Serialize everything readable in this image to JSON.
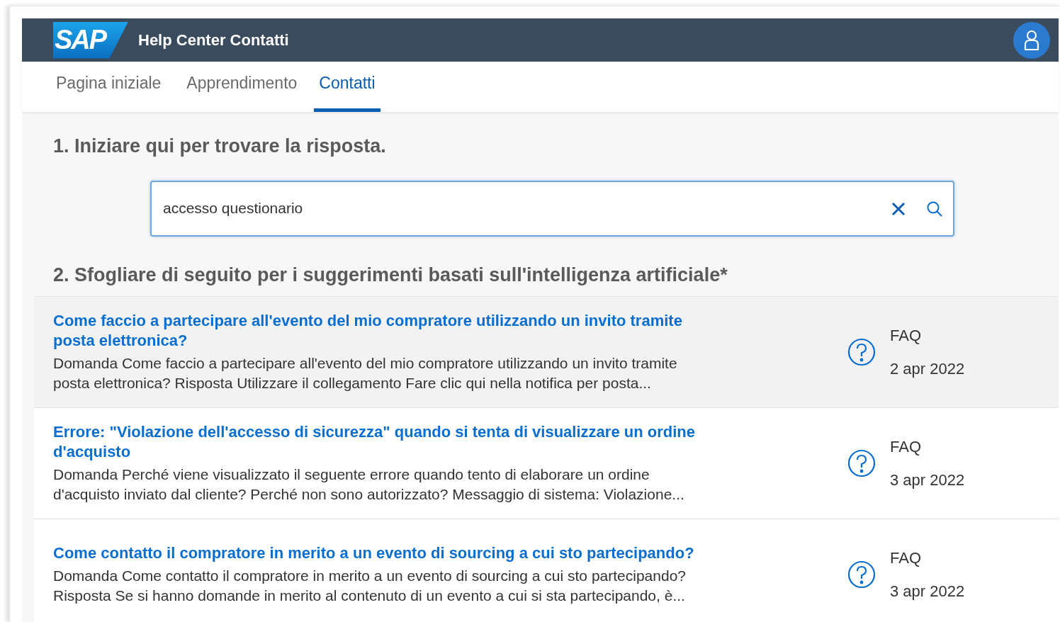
{
  "header": {
    "logo": "SAP",
    "title": "Help Center Contatti"
  },
  "tabs": [
    {
      "label": "Pagina iniziale",
      "selected": false
    },
    {
      "label": "Apprendimento",
      "selected": false
    },
    {
      "label": "Contatti",
      "selected": true
    }
  ],
  "step1": {
    "heading": "1. Iniziare qui per trovare la risposta.",
    "search": {
      "value": "accesso questionario"
    }
  },
  "step2": {
    "heading": "2. Sfogliare di seguito per i suggerimenti basati sull'intelligenza artificiale*"
  },
  "results": [
    {
      "title": "Come faccio a partecipare all'evento del mio compratore utilizzando un invito tramite posta elettronica?",
      "snippet": "Domanda Come faccio a partecipare all'evento del mio compratore utilizzando un invito tramite posta elettronica? Risposta Utilizzare il collegamento Fare clic qui nella notifica per posta...",
      "type": "FAQ",
      "date": "2 apr 2022",
      "selected": true
    },
    {
      "title": "Errore: \"Violazione dell'accesso di sicurezza\" quando si tenta di visualizzare un ordine d'acquisto",
      "snippet": "Domanda Perché viene visualizzato il seguente errore quando tento di elaborare un ordine d'acquisto inviato dal cliente? Perché non sono autorizzato? Messaggio di sistema: Violazione...",
      "type": "FAQ",
      "date": "3 apr 2022",
      "selected": false
    },
    {
      "title": "Come contatto il compratore in merito a un evento di sourcing a cui sto partecipando?",
      "snippet": "Domanda Come contatto il compratore in merito a un evento di sourcing a cui sto partecipando? Risposta Se si hanno domande in merito al contenuto di un evento a cui si sta partecipando, è...",
      "type": "FAQ",
      "date": "3 apr 2022",
      "selected": false
    }
  ]
}
